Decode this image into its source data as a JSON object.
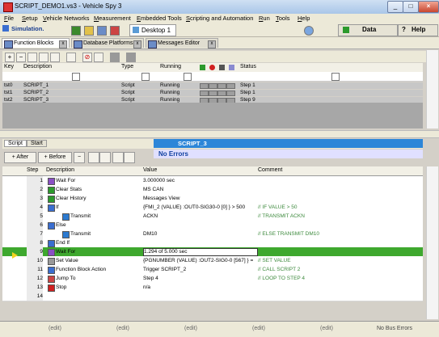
{
  "window": {
    "title": "SCRIPT_DEMO1.vs3 - Vehicle Spy 3"
  },
  "menu": [
    "File",
    "Setup",
    "Vehicle Networks",
    "Measurement",
    "Embedded Tools",
    "Scripting and Automation",
    "Run",
    "Tools",
    "Help"
  ],
  "toolbar": {
    "simulation": "Simulation.",
    "desktop": "Desktop 1",
    "data": "Data",
    "help": "Help"
  },
  "tabs": [
    "Function Blocks",
    "Database Platforms",
    "Messages Editor"
  ],
  "function_blocks": {
    "columns": [
      "Key",
      "Description",
      "Type",
      "Running",
      "Status"
    ],
    "rows": [
      {
        "key": "tst0",
        "description": "SCRIPT_1",
        "type": "Script",
        "running": "Running",
        "status": "Step 1"
      },
      {
        "key": "tst1",
        "description": "SCRIPT_2",
        "type": "Script",
        "running": "Running",
        "status": "Step 1"
      },
      {
        "key": "tst2",
        "description": "SCRIPT_3",
        "type": "Script",
        "running": "Running",
        "status": "Step 9"
      }
    ]
  },
  "script_panel": {
    "tabs": [
      "Script",
      "Start"
    ],
    "title": "SCRIPT_3",
    "message": "No Errors",
    "buttons": {
      "after": "After",
      "before": "Before"
    },
    "columns": [
      "Step",
      "Description",
      "Value",
      "Comment"
    ],
    "rows": [
      {
        "step": "1",
        "description": "Wait For",
        "value": "3.000000 sec",
        "comment": ""
      },
      {
        "step": "2",
        "description": "Clear Stats",
        "value": "MS CAN",
        "comment": ""
      },
      {
        "step": "3",
        "description": "Clear History",
        "value": "Messages View",
        "comment": ""
      },
      {
        "step": "4",
        "description": "If",
        "value": "{FMI_2 (VALUE) :OUT0-SIG30-0 [0] } > 500",
        "comment": "// IF VALUE > 50"
      },
      {
        "step": "5",
        "description": "Transmit",
        "value": "ACKN",
        "comment": "// TRANSMIT ACKN"
      },
      {
        "step": "6",
        "description": "Else",
        "value": "",
        "comment": ""
      },
      {
        "step": "7",
        "description": "Transmit",
        "value": "DM10",
        "comment": "// ELSE TRANSMIT DM10"
      },
      {
        "step": "8",
        "description": "End If",
        "value": "",
        "comment": ""
      },
      {
        "step": "9",
        "description": "Wait For",
        "value": "1.294 of 5.000 sec",
        "comment": ""
      },
      {
        "step": "10",
        "description": "Set Value",
        "value": "{PGNUMBER (VALUE) :OUT2-SIG0-0 [567] } =",
        "comment": "// SET VALUE"
      },
      {
        "step": "11",
        "description": "Function Block Action",
        "value": "Trigger SCRIPT_2",
        "comment": "// CALL SCRIPT 2"
      },
      {
        "step": "12",
        "description": "Jump To",
        "value": "Step 4",
        "comment": "// LOOP TO STEP 4"
      },
      {
        "step": "13",
        "description": "Stop",
        "value": "n/a",
        "comment": ""
      },
      {
        "step": "14",
        "description": "",
        "value": "",
        "comment": ""
      }
    ]
  },
  "statusbar": {
    "edit": "(edit)",
    "bus": "No Bus Errors"
  }
}
